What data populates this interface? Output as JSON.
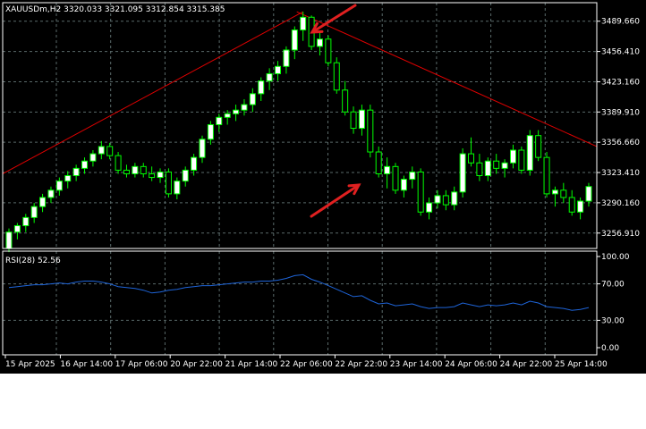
{
  "chart": {
    "symbol_header": "XAUUSDm,H2  3320.033 3321.095 3312.854 3315.385",
    "indicator_header": "RSI(28) 52.56",
    "price_axis_labels": [
      "3489.660",
      "3456.410",
      "3423.160",
      "3389.910",
      "3356.660",
      "3323.410",
      "3290.160",
      "3256.910"
    ],
    "rsi_axis_labels": [
      "100.00",
      "70.00",
      "30.00",
      "0.00"
    ],
    "time_axis_labels": [
      "15 Apr 2025",
      "16 Apr 14:00",
      "17 Apr 06:00",
      "20 Apr 22:00",
      "21 Apr 14:00",
      "22 Apr 06:00",
      "22 Apr 22:00",
      "23 Apr 14:00",
      "24 Apr 06:00",
      "24 Apr 22:00",
      "25 Apr 14:00"
    ],
    "colors": {
      "background": "#000000",
      "grid": "#5a6a6a",
      "bull_candle": "#ffffff",
      "bear_candle": "#000000",
      "wick": "#00ff00",
      "trendline": "#e00000",
      "rsi_line": "#1e64d8",
      "arrow": "#e02020"
    }
  },
  "chart_data": {
    "type": "candlestick",
    "price_ylim": [
      3240,
      3510
    ],
    "rsi_ylim": [
      0,
      100
    ],
    "candles": [
      [
        3240,
        3262,
        3236,
        3258
      ],
      [
        3258,
        3268,
        3250,
        3265
      ],
      [
        3265,
        3278,
        3258,
        3274
      ],
      [
        3274,
        3290,
        3268,
        3286
      ],
      [
        3286,
        3300,
        3280,
        3296
      ],
      [
        3296,
        3308,
        3290,
        3304
      ],
      [
        3304,
        3318,
        3298,
        3314
      ],
      [
        3314,
        3325,
        3306,
        3320
      ],
      [
        3320,
        3332,
        3314,
        3328
      ],
      [
        3328,
        3340,
        3322,
        3336
      ],
      [
        3336,
        3348,
        3330,
        3344
      ],
      [
        3344,
        3358,
        3338,
        3352
      ],
      [
        3352,
        3356,
        3338,
        3342
      ],
      [
        3342,
        3346,
        3322,
        3326
      ],
      [
        3326,
        3332,
        3318,
        3322
      ],
      [
        3322,
        3334,
        3318,
        3330
      ],
      [
        3330,
        3334,
        3318,
        3322
      ],
      [
        3322,
        3330,
        3314,
        3318
      ],
      [
        3318,
        3328,
        3312,
        3324
      ],
      [
        3324,
        3328,
        3296,
        3300
      ],
      [
        3300,
        3318,
        3294,
        3314
      ],
      [
        3314,
        3330,
        3308,
        3326
      ],
      [
        3326,
        3344,
        3320,
        3340
      ],
      [
        3340,
        3364,
        3334,
        3360
      ],
      [
        3360,
        3380,
        3354,
        3376
      ],
      [
        3376,
        3388,
        3368,
        3384
      ],
      [
        3384,
        3392,
        3376,
        3388
      ],
      [
        3388,
        3398,
        3380,
        3392
      ],
      [
        3392,
        3404,
        3386,
        3398
      ],
      [
        3398,
        3416,
        3390,
        3410
      ],
      [
        3410,
        3428,
        3402,
        3424
      ],
      [
        3424,
        3438,
        3414,
        3432
      ],
      [
        3432,
        3446,
        3424,
        3440
      ],
      [
        3440,
        3462,
        3432,
        3458
      ],
      [
        3458,
        3484,
        3448,
        3480
      ],
      [
        3480,
        3500,
        3468,
        3494
      ],
      [
        3494,
        3496,
        3458,
        3462
      ],
      [
        3462,
        3478,
        3452,
        3470
      ],
      [
        3470,
        3474,
        3440,
        3444
      ],
      [
        3444,
        3450,
        3410,
        3414
      ],
      [
        3414,
        3424,
        3386,
        3390
      ],
      [
        3390,
        3396,
        3366,
        3372
      ],
      [
        3372,
        3398,
        3364,
        3392
      ],
      [
        3392,
        3398,
        3340,
        3346
      ],
      [
        3346,
        3352,
        3318,
        3322
      ],
      [
        3322,
        3340,
        3306,
        3330
      ],
      [
        3330,
        3334,
        3300,
        3304
      ],
      [
        3304,
        3320,
        3296,
        3316
      ],
      [
        3316,
        3330,
        3306,
        3324
      ],
      [
        3324,
        3328,
        3276,
        3280
      ],
      [
        3280,
        3296,
        3272,
        3290
      ],
      [
        3290,
        3304,
        3284,
        3298
      ],
      [
        3298,
        3304,
        3282,
        3288
      ],
      [
        3288,
        3308,
        3282,
        3302
      ],
      [
        3302,
        3350,
        3296,
        3344
      ],
      [
        3344,
        3362,
        3330,
        3334
      ],
      [
        3334,
        3344,
        3314,
        3320
      ],
      [
        3320,
        3340,
        3314,
        3336
      ],
      [
        3336,
        3344,
        3322,
        3328
      ],
      [
        3328,
        3338,
        3318,
        3334
      ],
      [
        3334,
        3354,
        3328,
        3348
      ],
      [
        3348,
        3352,
        3322,
        3326
      ],
      [
        3326,
        3370,
        3320,
        3364
      ],
      [
        3364,
        3370,
        3336,
        3340
      ],
      [
        3340,
        3346,
        3296,
        3300
      ],
      [
        3300,
        3308,
        3286,
        3304
      ],
      [
        3304,
        3312,
        3290,
        3296
      ],
      [
        3296,
        3304,
        3276,
        3280
      ],
      [
        3280,
        3296,
        3272,
        3292
      ],
      [
        3292,
        3312,
        3286,
        3308
      ]
    ],
    "rsi": [
      66,
      67,
      68,
      69,
      69,
      70,
      71,
      70,
      72,
      73,
      73,
      72,
      70,
      67,
      66,
      65,
      63,
      60,
      61,
      63,
      64,
      66,
      67,
      68,
      68,
      69,
      70,
      71,
      72,
      72,
      73,
      73,
      74,
      76,
      79,
      80,
      75,
      72,
      68,
      64,
      60,
      56,
      57,
      52,
      48,
      49,
      46,
      47,
      48,
      45,
      43,
      44,
      44,
      45,
      49,
      47,
      45,
      47,
      46,
      47,
      49,
      47,
      51,
      49,
      45,
      44,
      43,
      41,
      42,
      44
    ],
    "trendlines": [
      {
        "from": [
          0,
          3322
        ],
        "to": [
          35,
          3500
        ]
      },
      {
        "from": [
          35,
          3500
        ],
        "to": [
          75,
          3352
        ]
      }
    ]
  }
}
